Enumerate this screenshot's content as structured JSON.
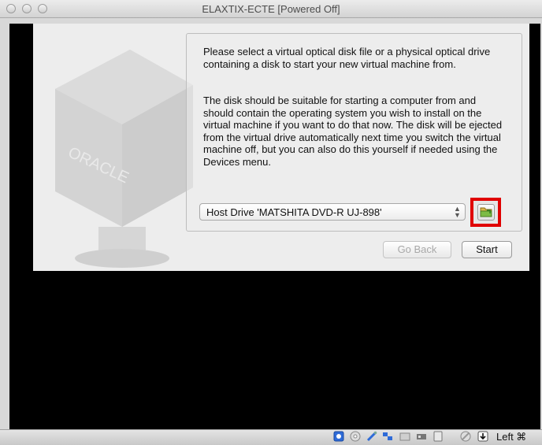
{
  "window": {
    "title": "ELAXTIX-ECTE [Powered Off]"
  },
  "dialog": {
    "paragraph1": "Please select a virtual optical disk file or a physical optical drive containing a disk to start your new virtual machine from.",
    "paragraph2": "The disk should be suitable for starting a computer from and should contain the operating system you wish to install on the virtual machine if you want to do that now. The disk will be ejected from the virtual drive automatically next time you switch the virtual machine off, but you can also do this yourself if needed using the Devices menu.",
    "disk_select": {
      "value": "Host Drive 'MATSHITA DVD-R   UJ-898'"
    },
    "buttons": {
      "go_back": "Go Back",
      "start": "Start"
    },
    "logo_text": "ORACLE"
  },
  "statusbar": {
    "icons": [
      "hard-disk-icon",
      "optical-disk-icon",
      "usb-icon",
      "network-icon",
      "shared-folder-icon",
      "video-capture-icon",
      "display-icon",
      "mouse-integration-icon",
      "host-key-icon"
    ],
    "host_key_label": "Left ⌘"
  }
}
